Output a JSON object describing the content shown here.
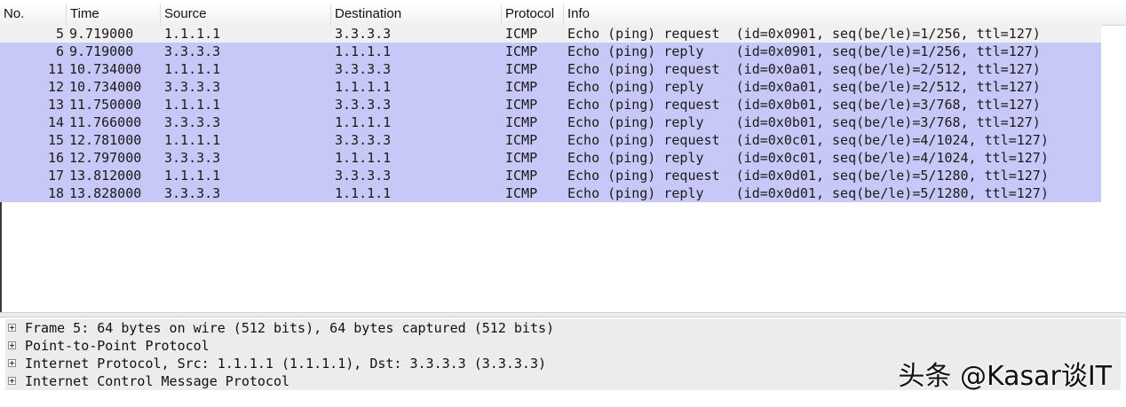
{
  "columns": {
    "no": "No.",
    "time": "Time",
    "source": "Source",
    "destination": "Destination",
    "protocol": "Protocol",
    "info": "Info"
  },
  "packets": [
    {
      "no": "5",
      "time": "9.719000",
      "source": "1.1.1.1",
      "destination": "3.3.3.3",
      "protocol": "ICMP",
      "info": "Echo (ping) request  (id=0x0901, seq(be/le)=1/256, ttl=127)"
    },
    {
      "no": "6",
      "time": "9.719000",
      "source": "3.3.3.3",
      "destination": "1.1.1.1",
      "protocol": "ICMP",
      "info": "Echo (ping) reply    (id=0x0901, seq(be/le)=1/256, ttl=127)"
    },
    {
      "no": "11",
      "time": "10.734000",
      "source": "1.1.1.1",
      "destination": "3.3.3.3",
      "protocol": "ICMP",
      "info": "Echo (ping) request  (id=0x0a01, seq(be/le)=2/512, ttl=127)"
    },
    {
      "no": "12",
      "time": "10.734000",
      "source": "3.3.3.3",
      "destination": "1.1.1.1",
      "protocol": "ICMP",
      "info": "Echo (ping) reply    (id=0x0a01, seq(be/le)=2/512, ttl=127)"
    },
    {
      "no": "13",
      "time": "11.750000",
      "source": "1.1.1.1",
      "destination": "3.3.3.3",
      "protocol": "ICMP",
      "info": "Echo (ping) request  (id=0x0b01, seq(be/le)=3/768, ttl=127)"
    },
    {
      "no": "14",
      "time": "11.766000",
      "source": "3.3.3.3",
      "destination": "1.1.1.1",
      "protocol": "ICMP",
      "info": "Echo (ping) reply    (id=0x0b01, seq(be/le)=3/768, ttl=127)"
    },
    {
      "no": "15",
      "time": "12.781000",
      "source": "1.1.1.1",
      "destination": "3.3.3.3",
      "protocol": "ICMP",
      "info": "Echo (ping) request  (id=0x0c01, seq(be/le)=4/1024, ttl=127)"
    },
    {
      "no": "16",
      "time": "12.797000",
      "source": "3.3.3.3",
      "destination": "1.1.1.1",
      "protocol": "ICMP",
      "info": "Echo (ping) reply    (id=0x0c01, seq(be/le)=4/1024, ttl=127)"
    },
    {
      "no": "17",
      "time": "13.812000",
      "source": "1.1.1.1",
      "destination": "3.3.3.3",
      "protocol": "ICMP",
      "info": "Echo (ping) request  (id=0x0d01, seq(be/le)=5/1280, ttl=127)"
    },
    {
      "no": "18",
      "time": "13.828000",
      "source": "3.3.3.3",
      "destination": "1.1.1.1",
      "protocol": "ICMP",
      "info": "Echo (ping) reply    (id=0x0d01, seq(be/le)=5/1280, ttl=127)"
    }
  ],
  "details": [
    "Frame 5: 64 bytes on wire (512 bits), 64 bytes captured (512 bits)",
    "Point-to-Point Protocol",
    "Internet Protocol, Src: 1.1.1.1 (1.1.1.1), Dst: 3.3.3.3 (3.3.3.3)",
    "Internet Control Message Protocol"
  ],
  "watermark": "头条 @Kasar谈IT",
  "colors": {
    "selected_row": "#f0f0f0",
    "icmp_row": "#c8c8f8",
    "detail_row": "#ececec"
  },
  "icons": {
    "expand": "plus-box-icon"
  }
}
